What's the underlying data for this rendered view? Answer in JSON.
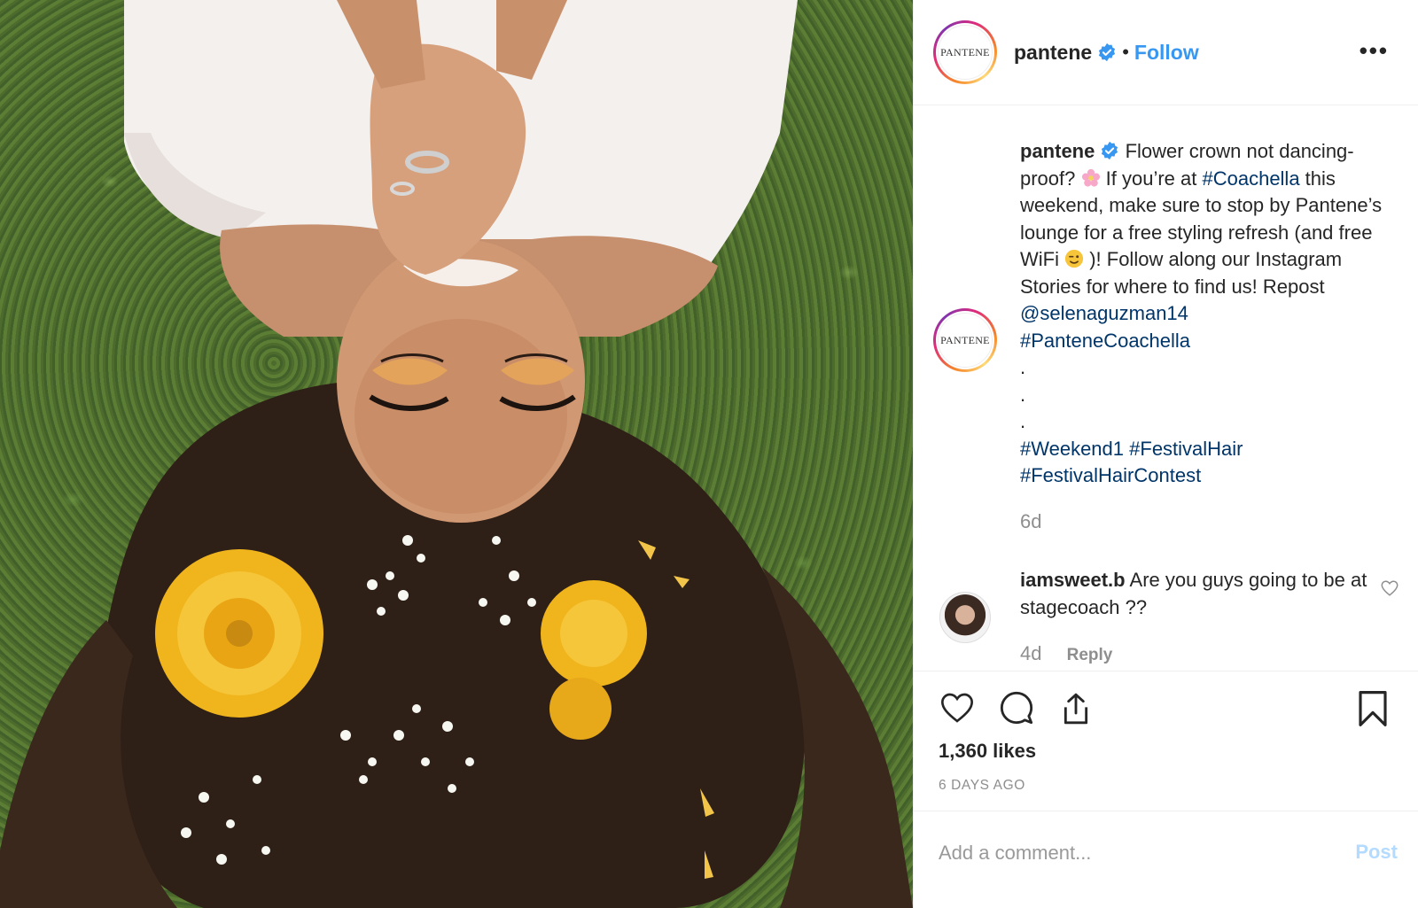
{
  "post": {
    "username": "pantene",
    "avatar_text": "PANTENE",
    "follow_label": "Follow",
    "separator": "•",
    "more_label": "•••"
  },
  "caption": {
    "username": "pantene",
    "text_1": "Flower crown not dancing-proof?",
    "text_2": " If you’re at ",
    "tag_coachella": "#Coachella",
    "text_3": " this weekend, make sure to stop by Pantene’s lounge for a free styling refresh (and free WiFi ",
    "text_4": " )! Follow along our Instagram Stories for where to find us! Repost ",
    "mention": "@selenaguzman14",
    "tag_pantenecoachella": "#PanteneCoachella",
    "dots": ".",
    "tag_weekend1": "#Weekend1",
    "tag_festivalhair": "#FestivalHair",
    "tag_festivalhaircontest": "#FestivalHairContest",
    "time": "6d"
  },
  "comment": {
    "username": "iamsweet.b",
    "text": "Are you guys going to be at stagecoach ??",
    "time": "4d",
    "reply_label": "Reply"
  },
  "stats": {
    "likes": "1,360 likes",
    "ago": "6 DAYS AGO"
  },
  "add_comment": {
    "placeholder": "Add a comment...",
    "post_label": "Post"
  },
  "colors": {
    "link": "#3897f0",
    "hashtag": "#003569",
    "muted": "#8e8e8e",
    "post_disabled": "#b3dbff"
  }
}
